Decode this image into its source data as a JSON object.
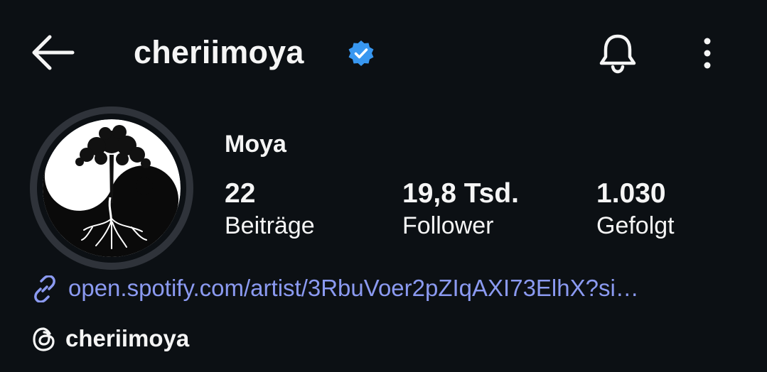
{
  "header": {
    "username": "cheriimoya",
    "back_icon": "arrow-left-icon",
    "verified_icon": "verified-badge-icon",
    "verified_color": "#3897f0",
    "bell_icon": "bell-icon",
    "more_icon": "more-vertical-icon"
  },
  "profile": {
    "display_name": "Moya",
    "avatar_icon": "yin-yang-tree-avatar",
    "stats": [
      {
        "value": "22",
        "label": "Beiträge"
      },
      {
        "value": "19,8 Tsd.",
        "label": "Follower"
      },
      {
        "value": "1.030",
        "label": "Gefolgt"
      }
    ],
    "link": {
      "icon": "link-icon",
      "text": "open.spotify.com/artist/3RbuVoer2pZIqAXI73ElhX?si…",
      "color": "#8b9af1"
    },
    "threads": {
      "icon": "threads-icon",
      "handle": "cheriimoya"
    }
  },
  "theme": {
    "background": "#0c1014",
    "text": "#f5f5f5"
  }
}
